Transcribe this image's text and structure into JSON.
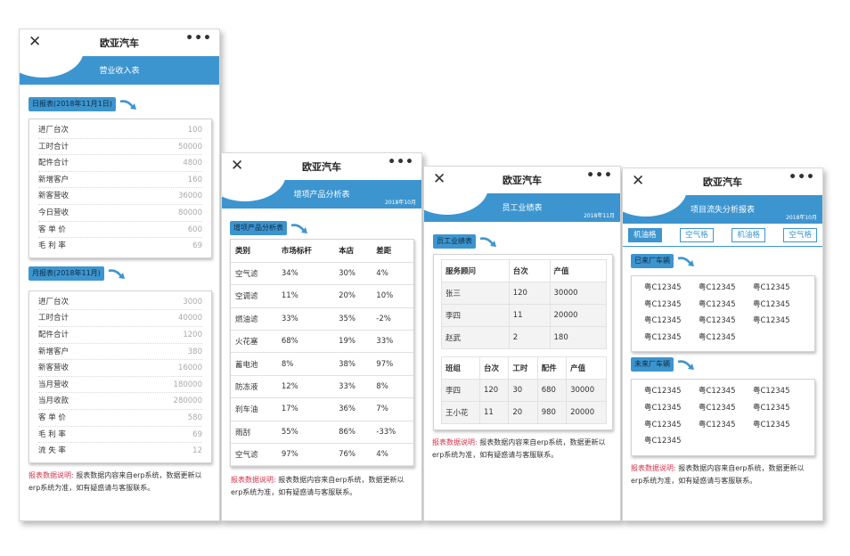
{
  "app_title": "欧亚汽车",
  "close_glyph": "✕",
  "more_glyph": "•••",
  "accent_color": "#3d95cf",
  "note_label_color": "#d3344c",
  "note": {
    "label": "报表数据说明:",
    "text": " 报表数据内容来自erp系统，数据更新以erp系统为准，如有疑惑请与客服联系。"
  },
  "screen1": {
    "banner_title": "营业收入表",
    "daily_tag": "日报表(2018年11月1日)",
    "daily": [
      {
        "k": "进厂台次",
        "v": "100"
      },
      {
        "k": "工时合计",
        "v": "50000"
      },
      {
        "k": "配件合计",
        "v": "4800"
      },
      {
        "k": "新增客户",
        "v": "160"
      },
      {
        "k": "新客营收",
        "v": "36000"
      },
      {
        "k": "今日营收",
        "v": "80000"
      },
      {
        "k": "客 单 价",
        "v": "600"
      },
      {
        "k": "毛 利 率",
        "v": "69"
      }
    ],
    "monthly_tag": "月报表(2018年11月)",
    "monthly": [
      {
        "k": "进厂台次",
        "v": "3000"
      },
      {
        "k": "工时合计",
        "v": "40000"
      },
      {
        "k": "配件合计",
        "v": "1200"
      },
      {
        "k": "新增客户",
        "v": "380"
      },
      {
        "k": "新客营收",
        "v": "16000"
      },
      {
        "k": "当月营收",
        "v": "180000"
      },
      {
        "k": "当月收款",
        "v": "280000"
      },
      {
        "k": "客 单 价",
        "v": "580"
      },
      {
        "k": "毛 利 率",
        "v": "69"
      },
      {
        "k": "流 失 率",
        "v": "12"
      }
    ]
  },
  "screen2": {
    "banner_title": "增项产品分析表",
    "banner_date": "2018年10月",
    "tag": "增项产品分析表",
    "headers": [
      "类别",
      "市场标杆",
      "本店",
      "差距"
    ],
    "rows": [
      [
        "空气滤",
        "34%",
        "30%",
        "4%"
      ],
      [
        "空调滤",
        "11%",
        "20%",
        "10%"
      ],
      [
        "燃油滤",
        "33%",
        "35%",
        "-2%"
      ],
      [
        "火花塞",
        "68%",
        "19%",
        "33%"
      ],
      [
        "蓄电池",
        "8%",
        "38%",
        "97%"
      ],
      [
        "防冻液",
        "12%",
        "33%",
        "8%"
      ],
      [
        "刹车油",
        "17%",
        "36%",
        "7%"
      ],
      [
        "雨刮",
        "55%",
        "86%",
        "-33%"
      ],
      [
        "空气滤",
        "97%",
        "76%",
        "4%"
      ]
    ]
  },
  "screen3": {
    "banner_title": "员工业绩表",
    "banner_date": "2018年11月",
    "tag": "员工业绩表",
    "advisor_headers": [
      "服务顾问",
      "台次",
      "产值"
    ],
    "advisor_rows": [
      [
        "张三",
        "120",
        "30000"
      ],
      [
        "李四",
        "11",
        "20000"
      ],
      [
        "赵武",
        "2",
        "180"
      ]
    ],
    "team_headers": [
      "班组",
      "台次",
      "工时",
      "配件",
      "产值"
    ],
    "team_rows": [
      [
        "李四",
        "120",
        "30",
        "680",
        "30000"
      ],
      [
        "王小花",
        "11",
        "20",
        "980",
        "20000"
      ]
    ]
  },
  "screen4": {
    "banner_title": "项目流失分析报表",
    "banner_date": "2018年10月",
    "tabs": [
      "机油格",
      "空气格",
      "机油格",
      "空气格"
    ],
    "came_tag": "已来厂车辆",
    "came": [
      "粤C12345",
      "粤C12345",
      "粤C12345",
      "粤C12345",
      "粤C12345",
      "粤C12345",
      "粤C12345",
      "粤C12345",
      "粤C12345",
      "粤C12345",
      "粤C12345"
    ],
    "notcame_tag": "未来厂车辆",
    "notcame": [
      "粤C12345",
      "粤C12345",
      "粤C12345",
      "粤C12345",
      "粤C12345",
      "粤C12345",
      "粤C12345",
      "粤C12345",
      "粤C12345",
      "粤C12345"
    ]
  }
}
